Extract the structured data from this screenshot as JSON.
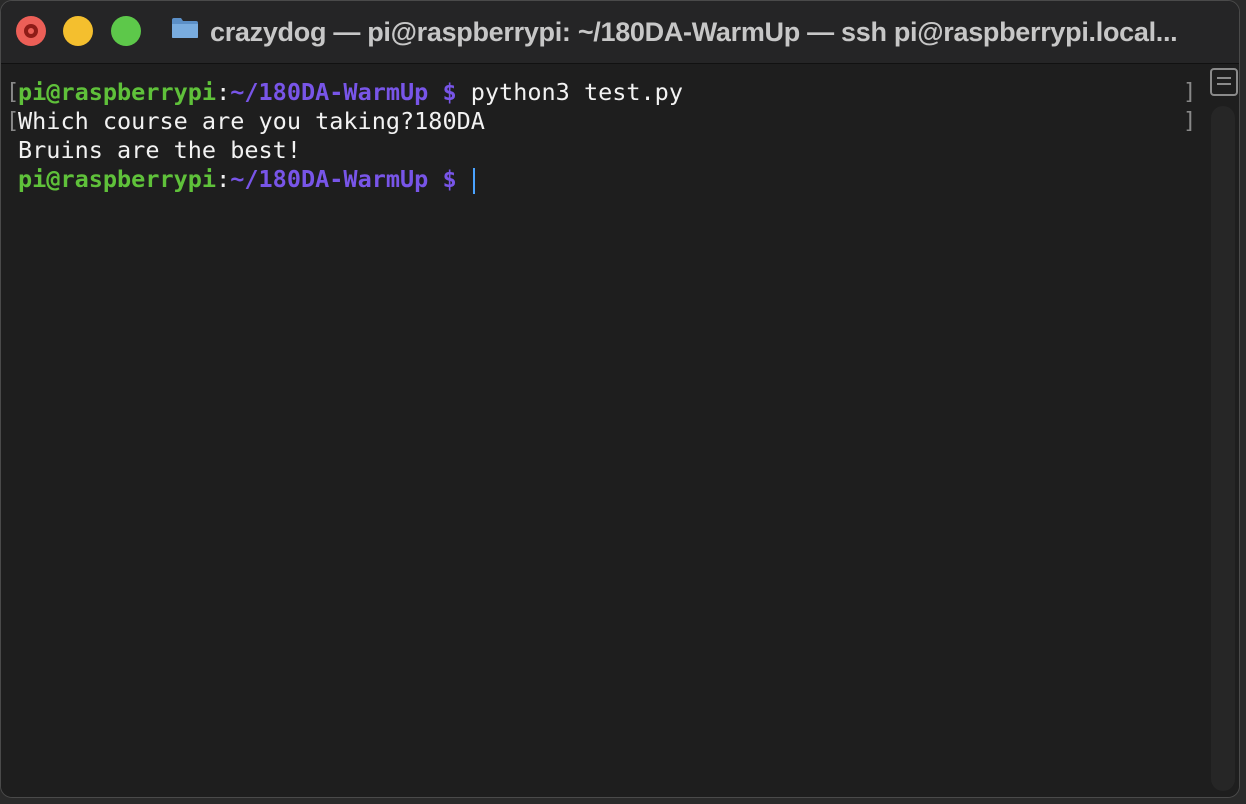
{
  "window": {
    "title": "crazydog — pi@raspberrypi: ~/180DA-WarmUp — ssh pi@raspberrypi.local..."
  },
  "terminal": {
    "lines": [
      {
        "user": "pi@raspberrypi",
        "colon": ":",
        "path": "~/180DA-WarmUp $",
        "command": " python3 test.py"
      },
      {
        "text": "Which course are you taking?180DA"
      },
      {
        "text": "Bruins are the best!"
      },
      {
        "user": "pi@raspberrypi",
        "colon": ":",
        "path": "~/180DA-WarmUp $",
        "command": " "
      }
    ],
    "marks": {
      "left": "[",
      "right": "]"
    }
  },
  "icons": {
    "folder": "folder-icon",
    "scrollback": "scrollback-toggle-icon"
  },
  "colors": {
    "user": "#5fc13a",
    "path": "#7855e8",
    "cursor": "#4aa3ff",
    "close": "#ec5f57",
    "minimize": "#f4bf2e",
    "maximize": "#5dc84a"
  }
}
